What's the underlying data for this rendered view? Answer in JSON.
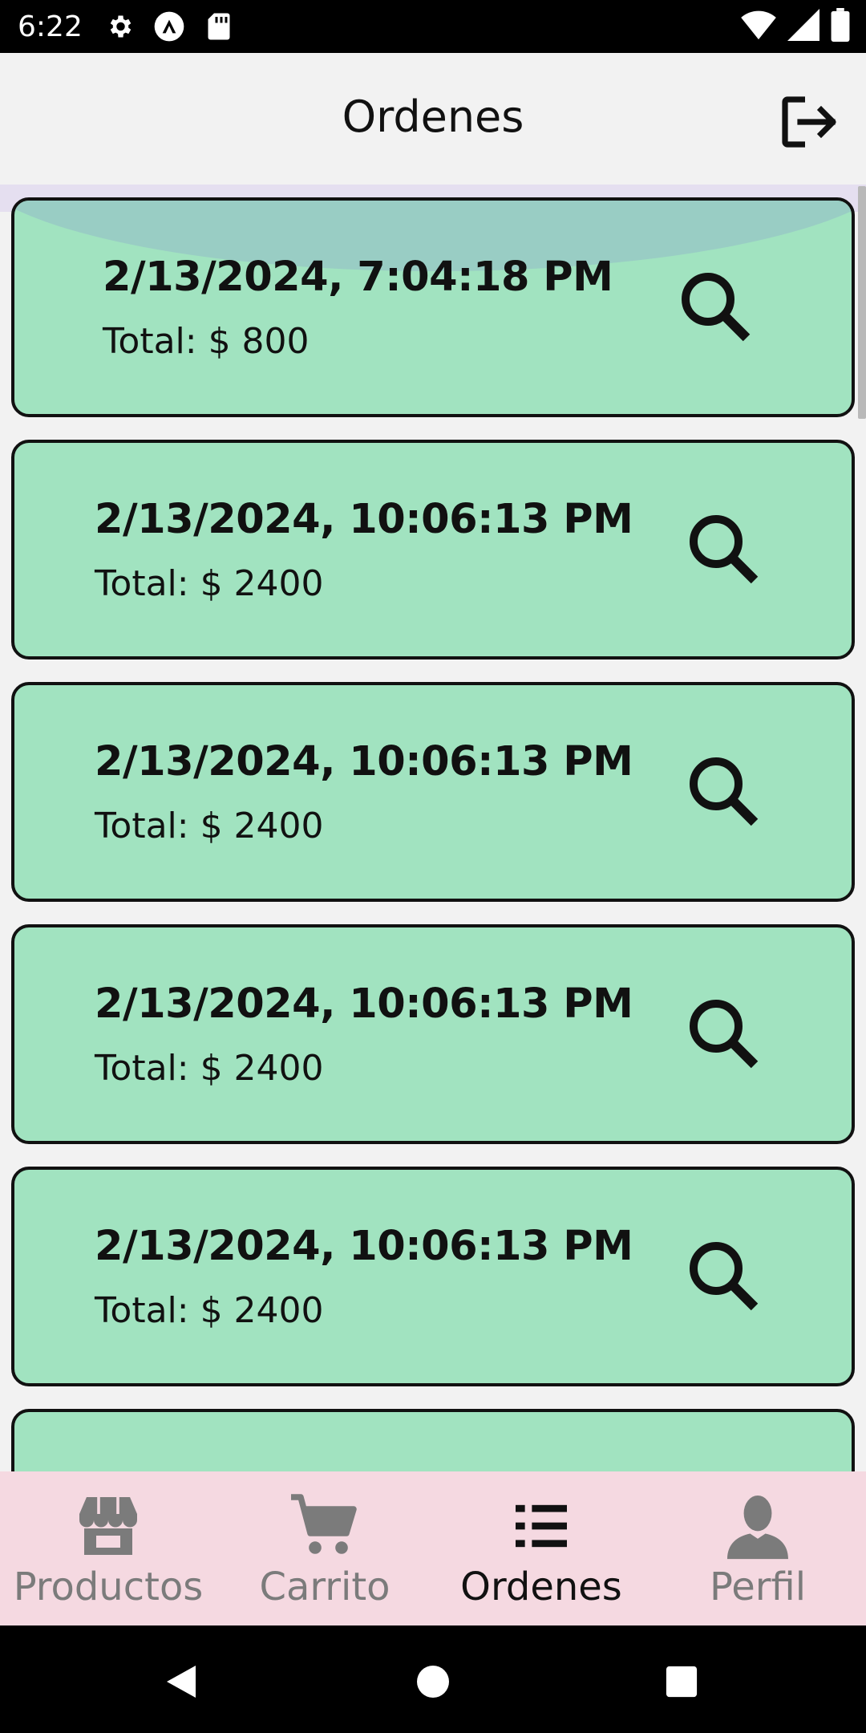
{
  "status_bar": {
    "time": "6:22",
    "left_icons": [
      "gear-icon",
      "a-circle-icon",
      "sd-card-icon"
    ],
    "right_icons": [
      "wifi-icon",
      "signal-icon",
      "battery-icon"
    ]
  },
  "header": {
    "title": "Ordenes",
    "logout_icon": "logout-icon"
  },
  "orders": [
    {
      "date": "2/13/2024, 7:04:18 PM",
      "total_label": "Total: $ 800"
    },
    {
      "date": "2/13/2024, 10:06:13 PM",
      "total_label": "Total: $ 2400"
    },
    {
      "date": "2/13/2024, 10:06:13 PM",
      "total_label": "Total: $ 2400"
    },
    {
      "date": "2/13/2024, 10:06:13 PM",
      "total_label": "Total: $ 2400"
    },
    {
      "date": "2/13/2024, 10:06:13 PM",
      "total_label": "Total: $ 2400"
    }
  ],
  "bottom_nav": {
    "items": [
      {
        "label": "Productos",
        "icon": "storefront-icon",
        "active": false
      },
      {
        "label": "Carrito",
        "icon": "cart-icon",
        "active": false
      },
      {
        "label": "Ordenes",
        "icon": "list-icon",
        "active": true
      },
      {
        "label": "Perfil",
        "icon": "person-icon",
        "active": false
      }
    ]
  },
  "colors": {
    "card_fill": "#a1e3c0",
    "card_border": "#111111",
    "nav_background": "#f5d9e1",
    "nav_inactive": "#7b7b7b",
    "nav_active": "#111111",
    "header_background": "#f2f2f2"
  }
}
